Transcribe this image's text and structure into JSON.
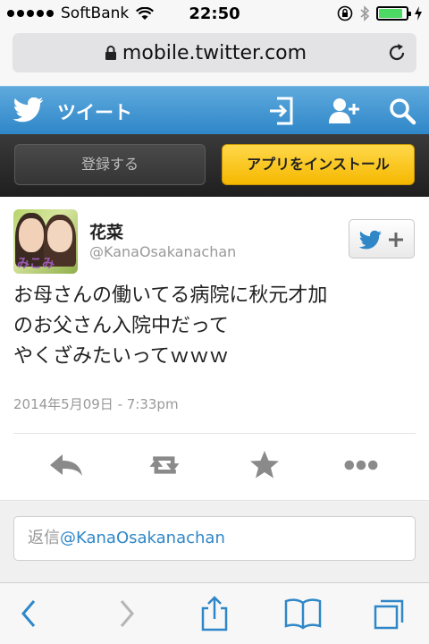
{
  "status_bar": {
    "carrier": "SoftBank",
    "time": "22:50",
    "battery_level": 0.85,
    "battery_color": "#4cd964"
  },
  "browser": {
    "url": "mobile.twitter.com"
  },
  "header": {
    "title": "ツイート",
    "accent": "#2f87c8"
  },
  "actions_bar": {
    "register_label": "登録する",
    "install_label": "アプリをインストール"
  },
  "tweet": {
    "avatar_caption": "みこみ",
    "name": "花菜",
    "handle": "@KanaOsakanachan",
    "text": "お母さんの働いてる病院に秋元才加\nのお父さん入院中だって\nやくざみたいってｗｗｗ",
    "date": "2014年5月09日 - 7:33pm"
  },
  "reply": {
    "prefix": "返信",
    "mention": "@KanaOsakanachan"
  },
  "icons": {
    "header": [
      "twitter-bird-icon",
      "sign-in-icon",
      "follow-user-icon",
      "search-icon"
    ],
    "tweet_actions": [
      "reply-icon",
      "retweet-icon",
      "favorite-icon",
      "more-icon"
    ],
    "toolbar": [
      "back-icon",
      "forward-icon",
      "share-icon",
      "bookmarks-icon",
      "tabs-icon"
    ]
  }
}
